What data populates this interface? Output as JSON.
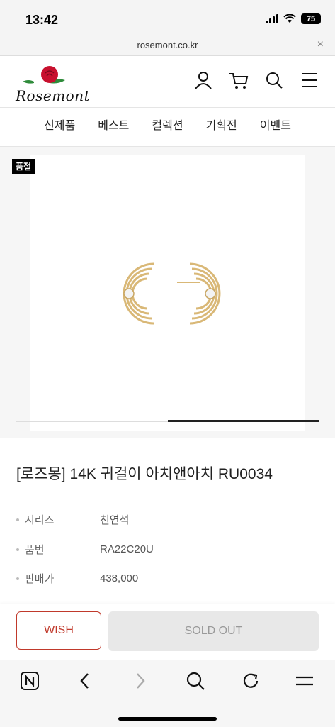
{
  "status": {
    "time": "13:42",
    "battery": "75"
  },
  "browser": {
    "url": "rosemont.co.kr",
    "close": "×"
  },
  "header": {
    "brand": "Rosemont"
  },
  "nav": [
    "신제품",
    "베스트",
    "컬렉션",
    "기획전",
    "이벤트"
  ],
  "gallery": {
    "badge": "품절",
    "slide_fraction": 0.5,
    "slide_index": 2,
    "slide_count": 2
  },
  "product": {
    "title": "[로즈몽] 14K 귀걸이 아치앤아치 RU0034",
    "info": [
      {
        "label": "시리즈",
        "value": "천연석"
      },
      {
        "label": "품번",
        "value": "RA22C20U"
      },
      {
        "label": "판매가",
        "value": "438,000"
      }
    ]
  },
  "actions": {
    "wish": "WISH",
    "soldout": "SOLD OUT"
  },
  "colors": {
    "accent": "#c0392b",
    "gold": "#d9b877"
  }
}
